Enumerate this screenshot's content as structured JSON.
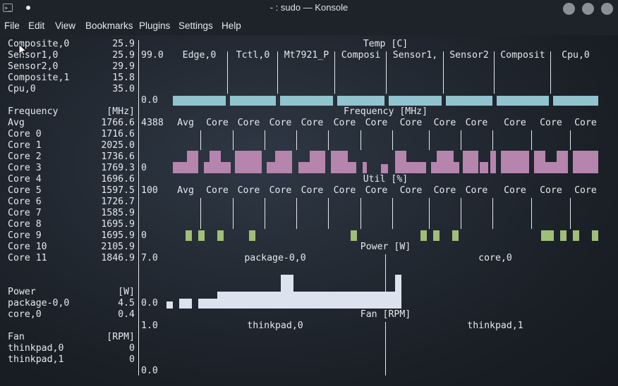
{
  "window": {
    "title": "- : sudo — Konsole"
  },
  "menu": [
    "File",
    "Edit",
    "View",
    "Bookmarks",
    "Plugins",
    "Settings",
    "Help"
  ],
  "colors": {
    "temp_bar": "#92c4cf",
    "freq_bar": "#b585ae",
    "util_bar": "#9fbf79",
    "power_bar": "#dde2ef"
  },
  "sidebar": {
    "temp_rows": [
      {
        "name": "Composite,0",
        "value": "25.9"
      },
      {
        "name": "Sensor1,0",
        "value": "25.9"
      },
      {
        "name": "Sensor2,0",
        "value": "29.9"
      },
      {
        "name": "Composite,1",
        "value": "15.8"
      },
      {
        "name": "Cpu,0",
        "value": "35.0"
      }
    ],
    "freq_header": {
      "name": "Frequency",
      "unit": "[MHz]"
    },
    "freq_rows": [
      {
        "name": "Avg",
        "value": "1766.6"
      },
      {
        "name": "Core 0",
        "value": "1716.6"
      },
      {
        "name": "Core 1",
        "value": "2025.0"
      },
      {
        "name": "Core 2",
        "value": "1736.6"
      },
      {
        "name": "Core 3",
        "value": "1769.3"
      },
      {
        "name": "Core 4",
        "value": "1696.6"
      },
      {
        "name": "Core 5",
        "value": "1597.5"
      },
      {
        "name": "Core 6",
        "value": "1726.7"
      },
      {
        "name": "Core 7",
        "value": "1585.9"
      },
      {
        "name": "Core 8",
        "value": "1695.9"
      },
      {
        "name": "Core 9",
        "value": "1695.9"
      },
      {
        "name": "Core 10",
        "value": "2105.9"
      },
      {
        "name": "Core 11",
        "value": "1846.9"
      }
    ],
    "power_header": {
      "name": "Power",
      "unit": "[W]"
    },
    "power_rows": [
      {
        "name": "package-0,0",
        "value": "4.5"
      },
      {
        "name": "core,0",
        "value": "0.4"
      }
    ],
    "fan_header": {
      "name": "Fan",
      "unit": "[RPM]"
    },
    "fan_rows": [
      {
        "name": "thinkpad,0",
        "value": "0"
      },
      {
        "name": "thinkpad,1",
        "value": "0"
      }
    ]
  },
  "panels": {
    "temp": {
      "title": "Temp [C]",
      "max": "99.0",
      "min": "0.0",
      "columns": [
        "Edge,0",
        "Tctl,0",
        "Mt7921_P",
        "Composi",
        "Sensor1,",
        "Sensor2",
        "Composit",
        "Cpu,0"
      ]
    },
    "freq": {
      "title": "Frequency [MHz]",
      "max": "4388",
      "min": "0",
      "columns": [
        "Avg",
        "Core",
        "Core",
        "Core",
        "Core",
        "Core",
        "Core",
        "Core",
        "Core",
        "Core",
        "Core",
        "Core",
        "Core"
      ]
    },
    "util": {
      "title": "Util [%]",
      "max": "100",
      "min": "0",
      "columns": [
        "Avg",
        "Core",
        "Core",
        "Core",
        "Core",
        "Core",
        "Core",
        "Core",
        "Core",
        "Core",
        "Core",
        "Core",
        "Core"
      ]
    },
    "power": {
      "title": "Power [W]",
      "max": "7.0",
      "min": "0.0",
      "columns": [
        "package-0,0",
        "core,0"
      ],
      "history_levels": [
        0.2,
        0,
        0.3,
        0.3,
        0,
        0.3,
        0.3,
        0.3,
        0.5,
        0.5,
        0.5,
        0.5,
        0.5,
        0.5,
        0.5,
        0.5,
        0.5,
        0.5,
        1.0,
        1.0,
        0.5,
        0.5,
        0.5,
        0.5,
        0.5,
        0.5,
        0.5,
        0.5,
        0.5,
        0.5,
        0.5,
        0.5,
        0.5,
        0.5,
        0.5,
        0.5,
        1.0
      ]
    },
    "fan": {
      "title": "Fan [RPM]",
      "max": "1.0",
      "min": "0.0",
      "columns": [
        "thinkpad,0",
        "thinkpad,1"
      ]
    }
  }
}
